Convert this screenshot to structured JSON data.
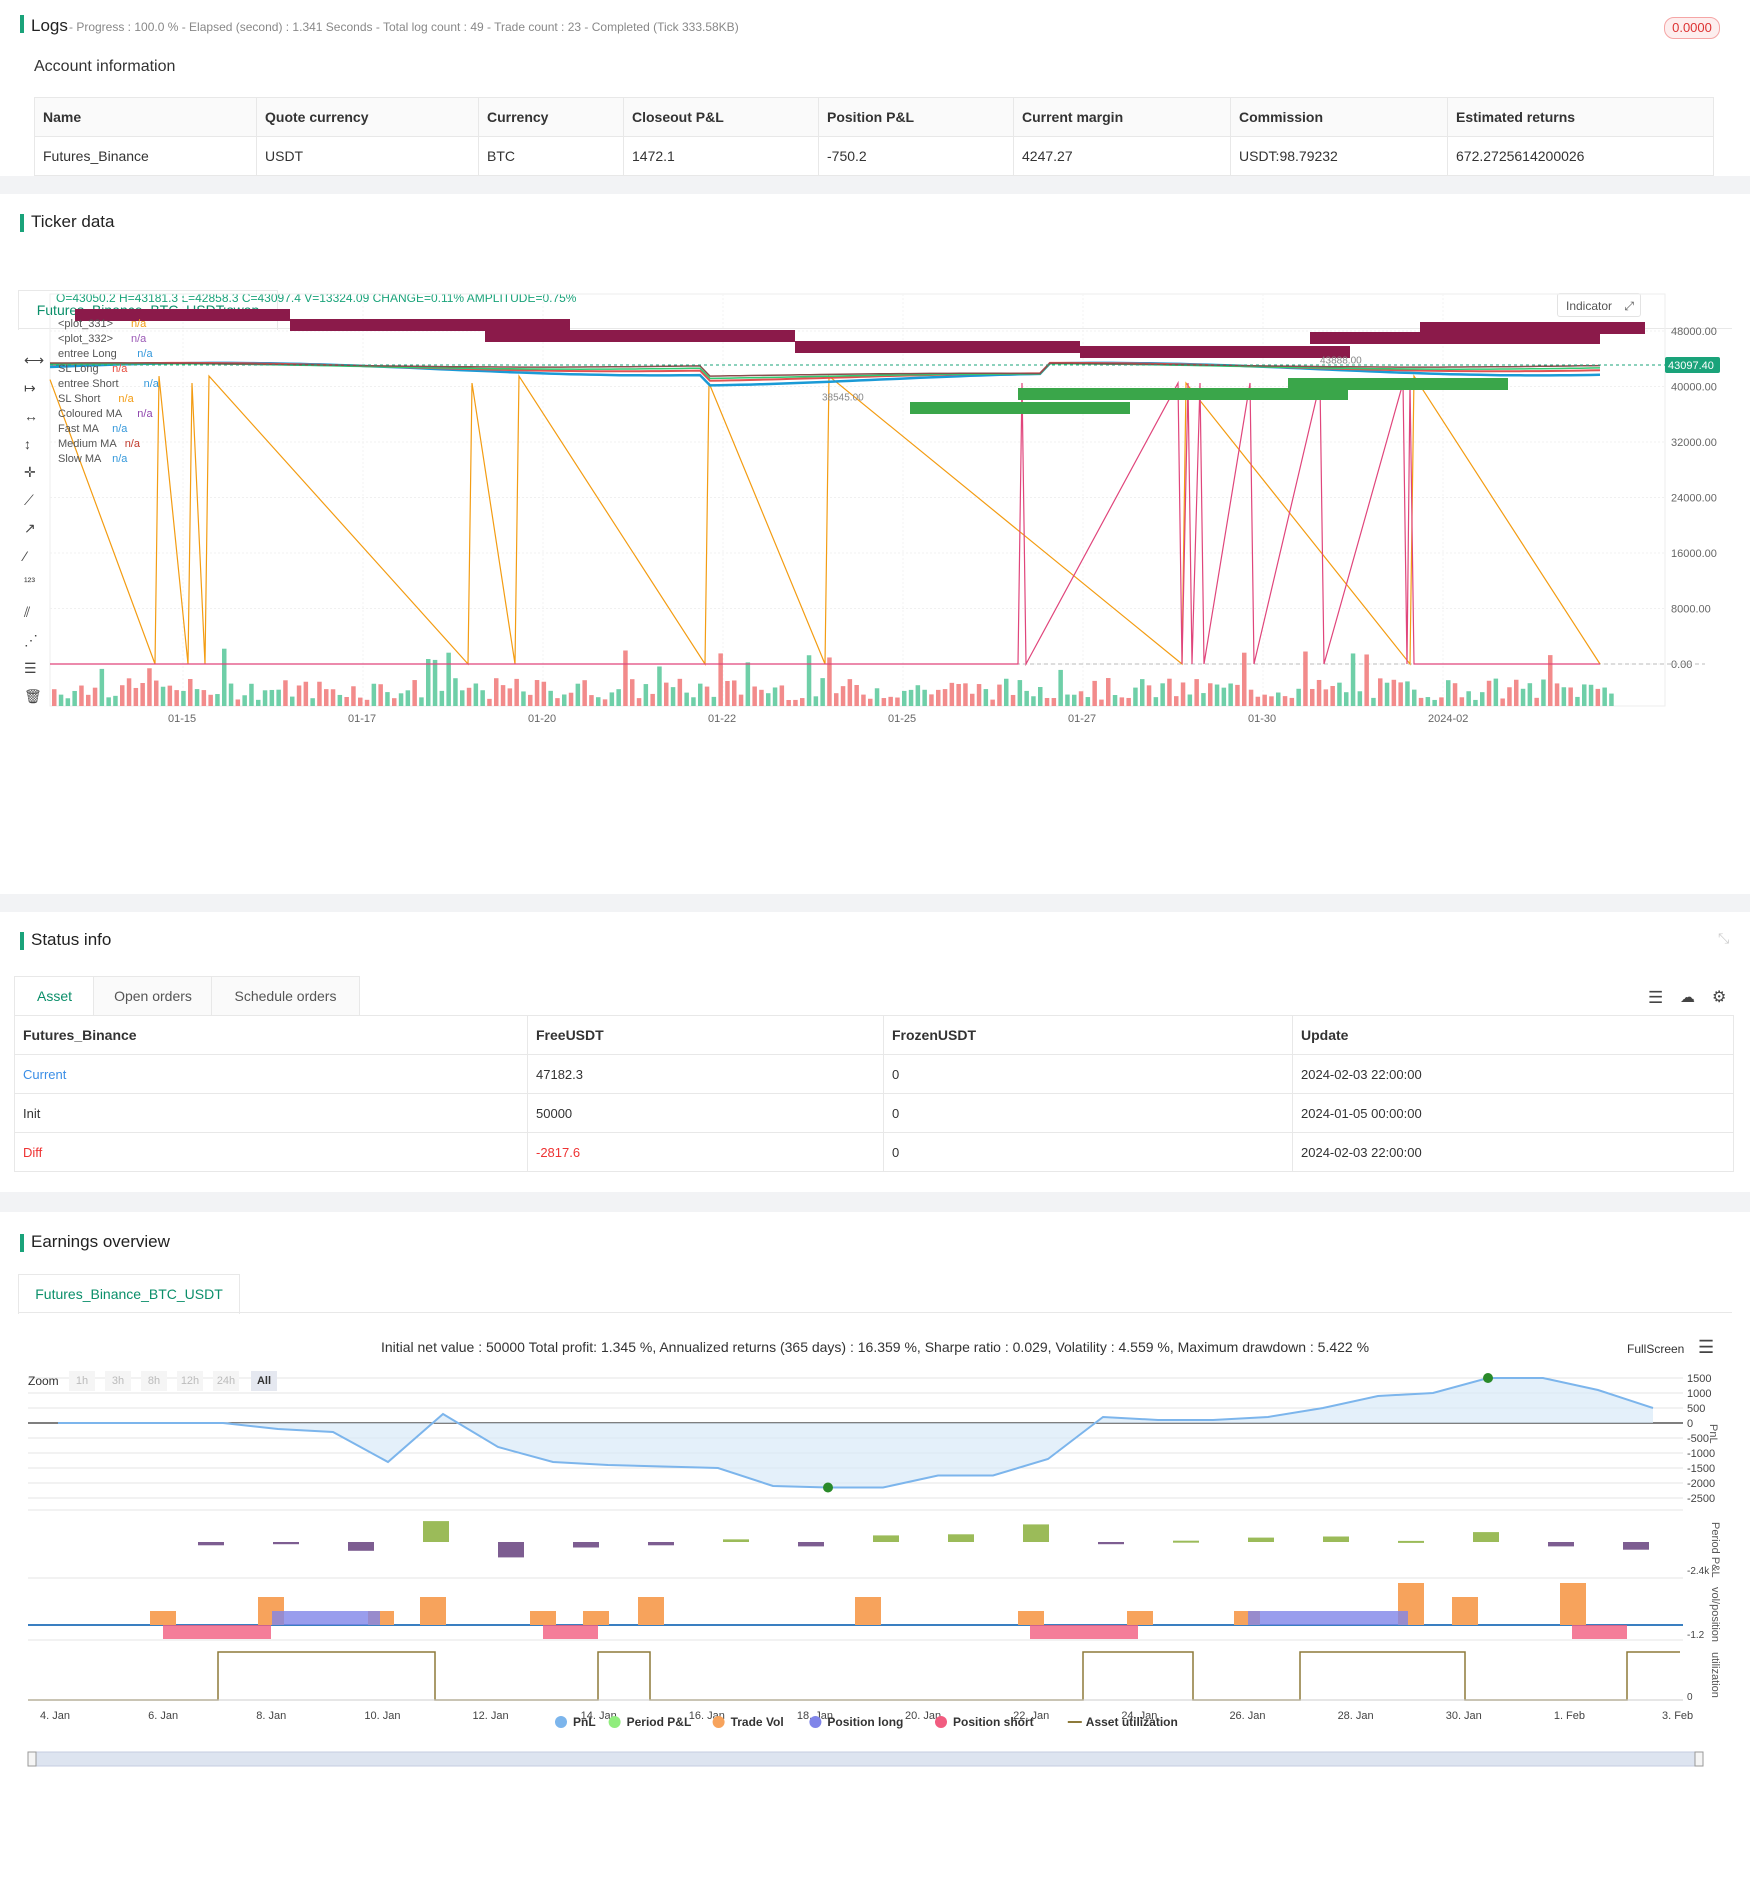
{
  "logs": {
    "title": "Logs",
    "progress_text": "- Progress : 100.0 % - Elapsed (second) : 1.341  Seconds - Total log count : 49 - Trade count : 23 - Completed (Tick 333.58KB)",
    "badge": "0.0000"
  },
  "account": {
    "title": "Account information",
    "headers": [
      "Name",
      "Quote currency",
      "Currency",
      "Closeout P&L",
      "Position P&L",
      "Current margin",
      "Commission",
      "Estimated returns"
    ],
    "row": [
      "Futures_Binance",
      "USDT",
      "BTC",
      "1472.1",
      "-750.2",
      "4247.27",
      "USDT:98.79232",
      "672.2725614200026"
    ]
  },
  "ticker": {
    "title": "Ticker data",
    "tab": "Futures_Binance_BTC_USDT:swap",
    "ohlc": "O=43050.2 H=43181.3 L=42858.3 C=43097.4 V=13324.09 CHANGE=0.11% AMPLITUDE=0.75%",
    "indicator_btn": "Indicator",
    "current_price": "43097.40",
    "legend": [
      {
        "name": "<plot_331>",
        "value": "n/a",
        "color": "#f39c12"
      },
      {
        "name": "<plot_332>",
        "value": "n/a",
        "color": "#9b59b6"
      },
      {
        "name": "entree Long",
        "value": "n/a",
        "color": "#3498db"
      },
      {
        "name": "SL Long",
        "value": "n/a",
        "color": "#e74c3c"
      },
      {
        "name": "entree Short",
        "value": "n/a",
        "color": "#3498db"
      },
      {
        "name": "SL Short",
        "value": "n/a",
        "color": "#f39c12"
      },
      {
        "name": "Coloured MA",
        "value": "n/a",
        "color": "#8e44ad"
      },
      {
        "name": "Fast MA",
        "value": "n/a",
        "color": "#3498db"
      },
      {
        "name": "Medium MA",
        "value": "n/a",
        "color": "#c0392b"
      },
      {
        "name": "Slow MA",
        "value": "n/a",
        "color": "#3498db"
      }
    ],
    "price_annotations": [
      "38545.00",
      "43888.00"
    ],
    "chart_data": {
      "type": "candlestick",
      "y_ticks": [
        48000,
        40000,
        32000,
        24000,
        16000,
        8000,
        0
      ],
      "y_tick_labels": [
        "48000.00",
        "40000.00",
        "32000.00",
        "24000.00",
        "16000.00",
        "8000.00",
        "0.00"
      ],
      "x_tick_labels": [
        "01-15",
        "01-17",
        "01-20",
        "01-22",
        "01-25",
        "01-27",
        "01-30",
        "2024-02"
      ]
    }
  },
  "status": {
    "title": "Status info",
    "tabs": [
      "Asset",
      "Open orders",
      "Schedule orders"
    ],
    "headers": [
      "Futures_Binance",
      "FreeUSDT",
      "FrozenUSDT",
      "Update"
    ],
    "rows": [
      {
        "label": "Current",
        "free": "47182.3",
        "frozen": "0",
        "update": "2024-02-03 22:00:00"
      },
      {
        "label": "Init",
        "free": "50000",
        "frozen": "0",
        "update": "2024-01-05 00:00:00"
      },
      {
        "label": "Diff",
        "free": "-2817.6",
        "frozen": "0",
        "update": "2024-02-03 22:00:00"
      }
    ]
  },
  "earnings": {
    "title": "Earnings overview",
    "tab": "Futures_Binance_BTC_USDT",
    "summary": "Initial net value : 50000 Total profit: 1.345 %, Annualized returns (365 days) : 16.359 %, Sharpe ratio : 0.029, Volatility : 4.559 %, Maximum drawdown : 5.422 %",
    "fullscreen": "FullScreen",
    "zoom_label": "Zoom",
    "zoom_buttons": [
      "1h",
      "3h",
      "8h",
      "12h",
      "24h",
      "All"
    ],
    "chart_data": {
      "type": "line",
      "x_tick_labels": [
        "4. Jan",
        "6. Jan",
        "8. Jan",
        "10. Jan",
        "12. Jan",
        "14. Jan",
        "16. Jan",
        "18. Jan",
        "20. Jan",
        "22. Jan",
        "24. Jan",
        "26. Jan",
        "28. Jan",
        "30. Jan",
        "1. Feb",
        "3. Feb"
      ],
      "pnl_y_ticks": [
        "1500",
        "1000",
        "500",
        "0",
        "-500",
        "-1000",
        "-1500",
        "-2000",
        "-2500"
      ],
      "pnl_axis_label": "PnL",
      "period_axis_label": "Period P&L",
      "period_min_label": "-2.4k",
      "vol_axis_label": "vol/position",
      "vol_min_label": "-1.2",
      "util_axis_label": "utilization",
      "util_min_label": "0",
      "legend": [
        {
          "name": "PnL",
          "color": "#7cb5ec"
        },
        {
          "name": "Period P&L",
          "color": "#90ed7d"
        },
        {
          "name": "Trade Vol",
          "color": "#f7a35c"
        },
        {
          "name": "Position long",
          "color": "#8085e9"
        },
        {
          "name": "Position short",
          "color": "#f15c80"
        },
        {
          "name": "Asset utilization",
          "color": "#8d7a3a"
        }
      ],
      "pnl": [
        0,
        0,
        0,
        0,
        -200,
        -300,
        -1300,
        300,
        -800,
        -1300,
        -1400,
        -1450,
        -1500,
        -2100,
        -2150,
        -2150,
        -1750,
        -1750,
        -1200,
        200,
        100,
        100,
        200,
        500,
        900,
        1000,
        1500,
        1500,
        1100,
        500
      ],
      "period_pnl": [
        -150,
        -100,
        -400,
        950,
        -700,
        -250,
        -150,
        120,
        -200,
        300,
        350,
        800,
        -100,
        60,
        200,
        250,
        50,
        450,
        -200,
        -350
      ]
    }
  }
}
